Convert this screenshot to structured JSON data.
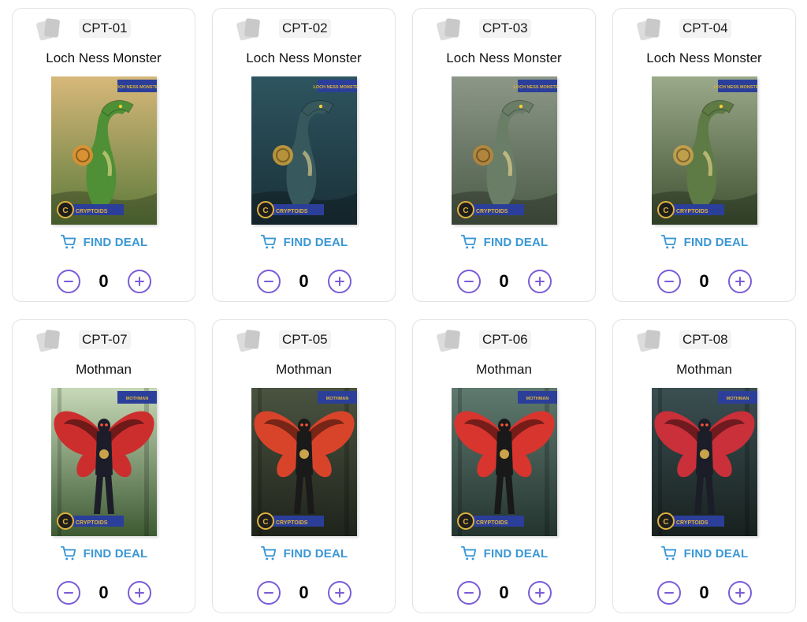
{
  "cards": [
    {
      "code": "CPT-01",
      "name": "Loch Ness Monster",
      "art": "loch",
      "banner": "LOCH NESS MONSTER",
      "bg": [
        "#d7b87a",
        "#5c7a3a"
      ],
      "creature": "#4f8f36",
      "accent": "#e0902f"
    },
    {
      "code": "CPT-02",
      "name": "Loch Ness Monster",
      "art": "loch",
      "banner": "LOCH NESS MONSTER",
      "bg": [
        "#2e5560",
        "#1a3038"
      ],
      "creature": "#37595d",
      "accent": "#c89b3a"
    },
    {
      "code": "CPT-03",
      "name": "Loch Ness Monster",
      "art": "loch",
      "banner": "LOCH NESS MONSTER",
      "bg": [
        "#8c9788",
        "#4b5a47"
      ],
      "creature": "#6a7d66",
      "accent": "#b9873a"
    },
    {
      "code": "CPT-04",
      "name": "Loch Ness Monster",
      "art": "loch",
      "banner": "LOCH NESS MONSTER",
      "bg": [
        "#9aa98a",
        "#3f5232"
      ],
      "creature": "#5e7a45",
      "accent": "#c9a24a"
    },
    {
      "code": "CPT-07",
      "name": "Mothman",
      "art": "moth",
      "banner": "MOTHMAN",
      "bg": [
        "#c7d9b8",
        "#3d5a33"
      ],
      "creature": "#1d1d2a",
      "accent": "#cc2e2e"
    },
    {
      "code": "CPT-05",
      "name": "Mothman",
      "art": "moth",
      "banner": "MOTHMAN",
      "bg": [
        "#4a5340",
        "#1f241b"
      ],
      "creature": "#1a1a1a",
      "accent": "#d8442a"
    },
    {
      "code": "CPT-06",
      "name": "Mothman",
      "art": "moth",
      "banner": "MOTHMAN",
      "bg": [
        "#5f7a6f",
        "#24342f"
      ],
      "creature": "#191919",
      "accent": "#d7352e"
    },
    {
      "code": "CPT-08",
      "name": "Mothman",
      "art": "moth",
      "banner": "MOTHMAN",
      "bg": [
        "#3b4f52",
        "#18211f"
      ],
      "creature": "#1b1d28",
      "accent": "#c9303a"
    }
  ],
  "brand": "CRYPTOIDS",
  "deal_label": "FIND DEAL",
  "quantity": "0",
  "colors": {
    "link": "#3a97d4",
    "stepper": "#7a5cd6",
    "border": "#e3e3e3",
    "banner": "#2b3f9a",
    "gold": "#e0b23a"
  },
  "icons": {
    "card": "card-stack-icon",
    "cart": "cart-icon",
    "minus": "minus-circle-icon",
    "plus": "plus-circle-icon",
    "coin": "crypto-coin-icon"
  }
}
